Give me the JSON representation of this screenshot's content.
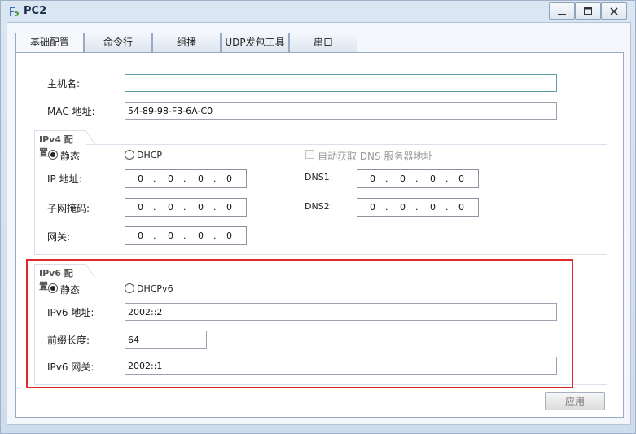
{
  "window": {
    "title": "PC2",
    "min_icon": "minimize-icon",
    "max_icon": "maximize-icon",
    "close_icon": "close-icon"
  },
  "tabs": [
    "基础配置",
    "命令行",
    "组播",
    "UDP发包工具",
    "串口"
  ],
  "basic": {
    "hostname_label": "主机名:",
    "hostname_value": "",
    "mac_label": "MAC 地址:",
    "mac_value": "54-89-98-F3-6A-C0"
  },
  "ipv4": {
    "group_title": "IPv4 配置",
    "static_label": "静态",
    "dhcp_label": "DHCP",
    "auto_dns_label": "自动获取 DNS 服务器地址",
    "ip_label": "IP 地址:",
    "ip": [
      "0",
      "0",
      "0",
      "0"
    ],
    "mask_label": "子网掩码:",
    "mask": [
      "0",
      "0",
      "0",
      "0"
    ],
    "gateway_label": "网关:",
    "gateway": [
      "0",
      "0",
      "0",
      "0"
    ],
    "dns1_label": "DNS1:",
    "dns1": [
      "0",
      "0",
      "0",
      "0"
    ],
    "dns2_label": "DNS2:",
    "dns2": [
      "0",
      "0",
      "0",
      "0"
    ],
    "mode": "static"
  },
  "ipv6": {
    "group_title": "IPv6 配置",
    "static_label": "静态",
    "dhcp_label": "DHCPv6",
    "address_label": "IPv6 地址:",
    "address_value": "2002::2",
    "prefix_label": "前缀长度:",
    "prefix_value": "64",
    "gateway_label": "IPv6 网关:",
    "gateway_value": "2002::1",
    "mode": "static"
  },
  "apply_label": "应用",
  "colors": {
    "highlight": "#e02828",
    "title_bg": "#cfdcec"
  }
}
